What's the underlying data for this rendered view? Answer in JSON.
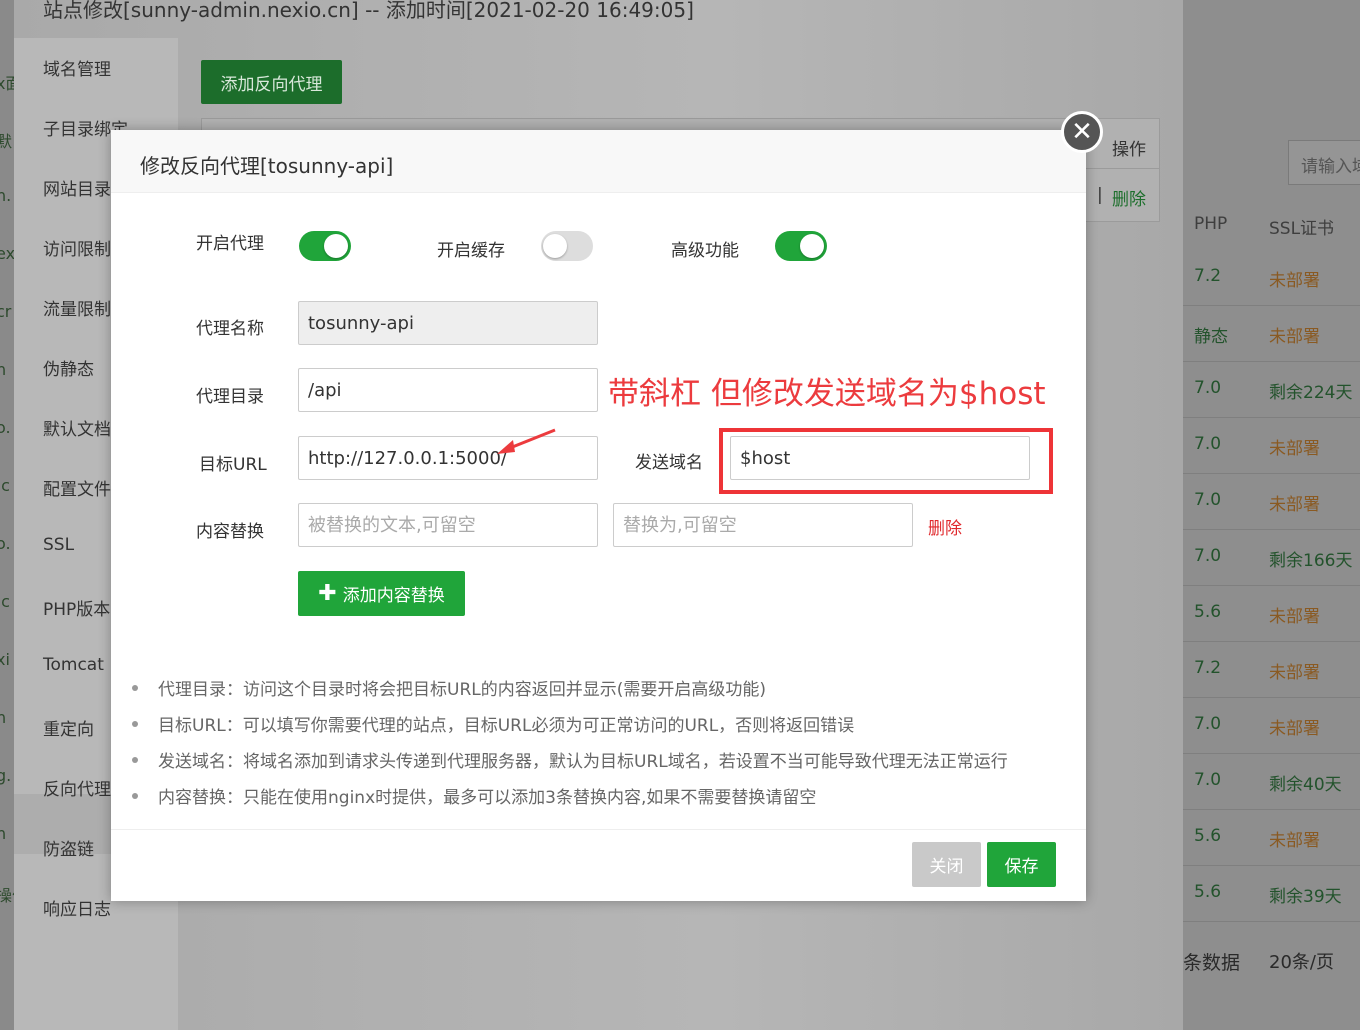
{
  "background": {
    "left_fragments": [
      "x面",
      "默",
      "n.",
      "ex",
      "cr",
      "n",
      "o.",
      ".c",
      "o.",
      ".c",
      "xi",
      "n",
      "g.",
      "n",
      "操作"
    ],
    "panel_title": "站点修改[sunny-admin.nexio.cn] -- 添加时间[2021-02-20 16:49:05]",
    "sidebar": [
      "域名管理",
      "子目录绑定",
      "网站目录",
      "访问限制",
      "流量限制",
      "伪静态",
      "默认文档",
      "配置文件",
      "SSL",
      "PHP版本",
      "Tomcat",
      "重定向",
      "反向代理",
      "防盗链",
      "响应日志"
    ],
    "active_sidebar": "反向代理",
    "add_proxy_label": "添加反向代理",
    "table_header_action": "操作",
    "table_delete": "删除",
    "table_sep": "|",
    "search_placeholder": "请输入域",
    "columns": {
      "php": "PHP",
      "ssl": "SSL证书"
    },
    "rows": [
      {
        "php": "7.2",
        "ssl": "未部署",
        "ok": false
      },
      {
        "php": "静态",
        "ssl": "未部署",
        "ok": false
      },
      {
        "php": "7.0",
        "ssl": "剩余224天",
        "ok": true
      },
      {
        "php": "7.0",
        "ssl": "未部署",
        "ok": false
      },
      {
        "php": "7.0",
        "ssl": "未部署",
        "ok": false
      },
      {
        "php": "7.0",
        "ssl": "剩余166天",
        "ok": true
      },
      {
        "php": "5.6",
        "ssl": "未部署",
        "ok": false
      },
      {
        "php": "7.2",
        "ssl": "未部署",
        "ok": false
      },
      {
        "php": "7.0",
        "ssl": "未部署",
        "ok": false
      },
      {
        "php": "7.0",
        "ssl": "剩余40天",
        "ok": true
      },
      {
        "php": "5.6",
        "ssl": "未部署",
        "ok": false
      },
      {
        "php": "5.6",
        "ssl": "剩余39天",
        "ok": true
      }
    ],
    "pager_text": "条数据",
    "page_size": "20条/页"
  },
  "modal": {
    "title": "修改反向代理[tosunny-api]",
    "close_icon": "close-icon",
    "toggles": [
      {
        "label": "开启代理",
        "on": true
      },
      {
        "label": "开启缓存",
        "on": false
      },
      {
        "label": "高级功能",
        "on": true
      }
    ],
    "fields": {
      "name_label": "代理名称",
      "name_value": "tosunny-api",
      "dir_label": "代理目录",
      "dir_value": "/api",
      "url_label": "目标URL",
      "url_value": "http://127.0.0.1:5000/",
      "host_label": "发送域名",
      "host_value": "$host",
      "replace_label": "内容替换",
      "replace_from_placeholder": "被替换的文本,可留空",
      "replace_to_placeholder": "替换为,可留空",
      "replace_delete": "删除"
    },
    "add_replace_label": "添加内容替换",
    "annotation": "带斜杠 但修改发送域名为$host",
    "annotation_color": "#ec3b3e",
    "notes": [
      "代理目录：访问这个目录时将会把目标URL的内容返回并显示(需要开启高级功能)",
      "目标URL：可以填写你需要代理的站点，目标URL必须为可正常访问的URL，否则将返回错误",
      "发送域名：将域名添加到请求头传递到代理服务器，默认为目标URL域名，若设置不当可能导致代理无法正常运行",
      "内容替换：只能在使用nginx时提供，最多可以添加3条替换内容,如果不需要替换请留空"
    ],
    "close_label": "关闭",
    "save_label": "保存",
    "accent": "#20a53a"
  }
}
